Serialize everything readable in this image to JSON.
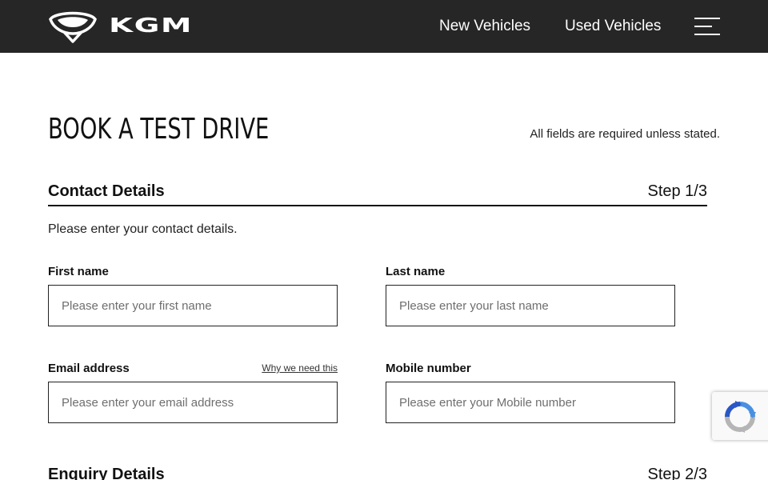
{
  "header": {
    "logo_text": "KGM",
    "nav": {
      "new_vehicles": "New Vehicles",
      "used_vehicles": "Used Vehicles"
    }
  },
  "page": {
    "title": "BOOK A TEST DRIVE",
    "required_note": "All fields are required unless stated."
  },
  "contact_section": {
    "title": "Contact Details",
    "step": "Step 1/3",
    "description": "Please enter your contact details.",
    "fields": {
      "first_name": {
        "label": "First name",
        "placeholder": "Please enter your first name",
        "value": ""
      },
      "last_name": {
        "label": "Last name",
        "placeholder": "Please enter your last name",
        "value": ""
      },
      "email": {
        "label": "Email address",
        "help": "Why we need this",
        "placeholder": "Please enter your email address",
        "value": ""
      },
      "mobile": {
        "label": "Mobile number",
        "placeholder": "Please enter your Mobile number",
        "value": ""
      }
    }
  },
  "enquiry_section": {
    "title": "Enquiry Details",
    "step": "Step 2/3"
  },
  "colors": {
    "header_bg": "#262626",
    "text": "#111111",
    "border": "#222222",
    "recaptcha_blue": "#4a90e2",
    "recaptcha_gray": "#b5b5b5"
  },
  "icons": {
    "logo": "kgm-wing-emblem-icon",
    "menu": "hamburger-menu-icon",
    "recaptcha": "recaptcha-icon"
  }
}
